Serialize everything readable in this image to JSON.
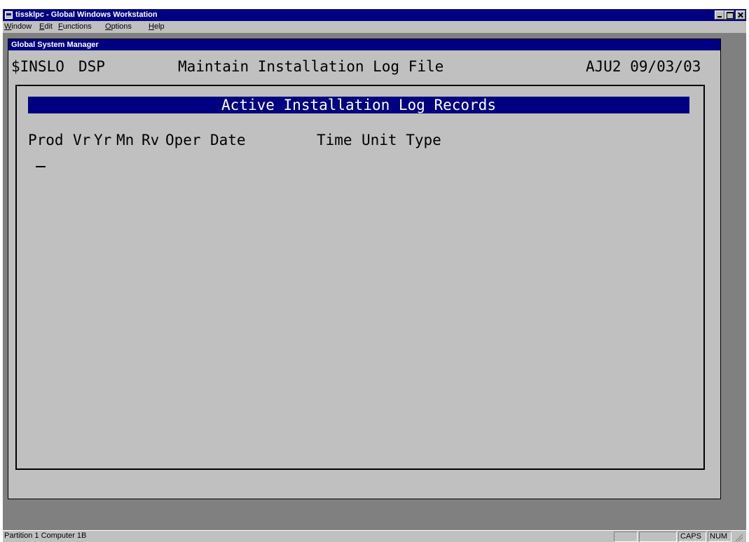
{
  "window": {
    "title": "tissklpc - Global Windows Workstation"
  },
  "menubar": {
    "items": [
      {
        "accel": "W",
        "rest": "indow"
      },
      {
        "accel": "E",
        "rest": "dit"
      },
      {
        "accel": "F",
        "rest": "unctions"
      },
      {
        "accel": "O",
        "rest": "ptions"
      },
      {
        "accel": "H",
        "rest": "elp"
      }
    ]
  },
  "child_window": {
    "title": "Global System Manager"
  },
  "screen": {
    "program_id": "$INSLO",
    "mode": "DSP",
    "title": "Maintain Installation Log File",
    "user_date": "AJU2 09/03/03",
    "list_header": "Active Installation Log Records",
    "columns": {
      "prod": "Prod",
      "vr": "Vr",
      "yr": "Yr",
      "mn": "Mn",
      "rv": "Rv",
      "oper": "Oper",
      "date": "Date",
      "time": "Time",
      "unit_type": "Unit Type"
    }
  },
  "statusbar": {
    "partition": "Partition 1 Computer 1B",
    "caps": "CAPS",
    "num": "NUM"
  },
  "colors": {
    "title_bar": "#000080",
    "face": "#c0c0c0",
    "workspace": "#808080"
  }
}
